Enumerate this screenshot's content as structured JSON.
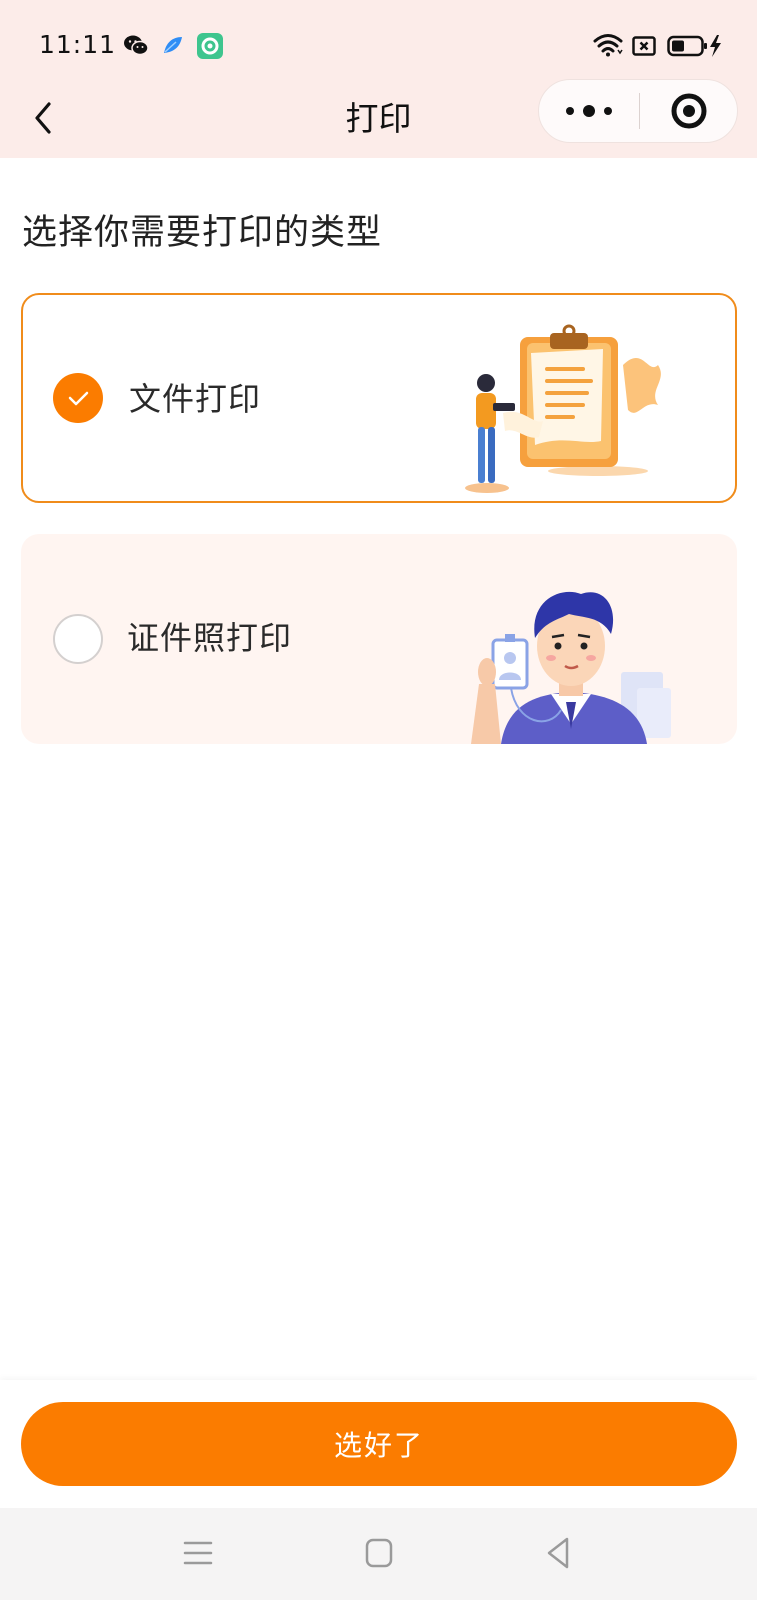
{
  "status_bar": {
    "time": "11:11",
    "notification_icons": [
      "wechat-icon",
      "feather-app-icon",
      "green-app-icon"
    ],
    "system_icons": [
      "wifi-icon",
      "sim-card-icon",
      "battery-charging-icon"
    ]
  },
  "nav": {
    "title": "打印",
    "back_icon": "chevron-left-icon",
    "more_icon": "more-dots-icon",
    "close_icon": "target-close-icon"
  },
  "main": {
    "heading": "选择你需要打印的类型",
    "options": [
      {
        "label": "文件打印",
        "selected": true,
        "illustration": "document-clipboard-illustration"
      },
      {
        "label": "证件照打印",
        "selected": false,
        "illustration": "id-photo-person-illustration"
      }
    ]
  },
  "confirm_button": {
    "label": "选好了"
  },
  "colors": {
    "accent": "#fb7c00",
    "header_bg": "#fcece9",
    "selected_border": "#f08c1b",
    "unselected_card_bg": "#fff5f1"
  },
  "system_nav": {
    "icons": [
      "menu-lines-icon",
      "home-square-icon",
      "back-triangle-icon"
    ]
  }
}
